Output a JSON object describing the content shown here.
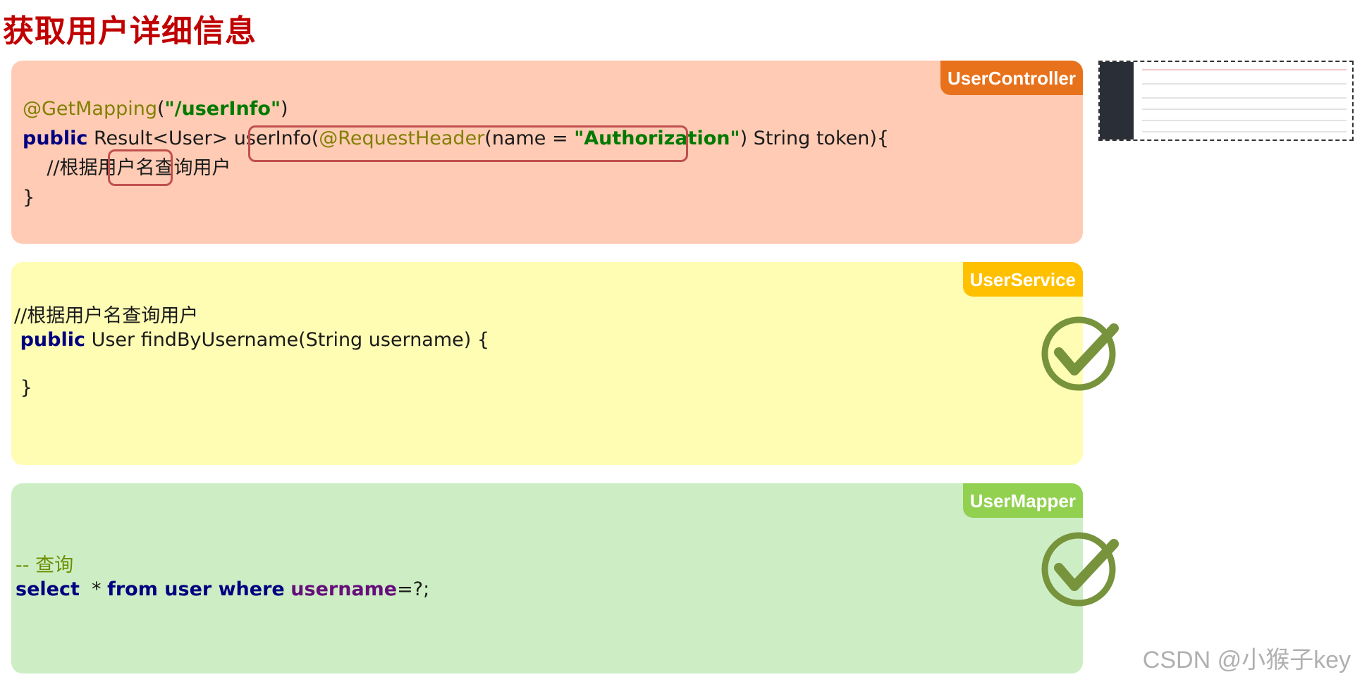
{
  "title": "获取用户详细信息",
  "controller": {
    "badge": "UserController",
    "line1_ann": "@GetMapping",
    "line1_open": "(",
    "line1_str": "\"/userInfo\"",
    "line1_close": ")",
    "line2_kw": "public",
    "line2_a": " Result<User> userInfo(",
    "line2_ann": "@RequestHeader",
    "line2_b": "(name = ",
    "line2_str": "\"Authorization\"",
    "line2_c": ") String token){",
    "line3": "    //根据用户名查询用户",
    "line4": "}"
  },
  "service": {
    "badge": "UserService",
    "line1": "//根据用户名查询用户",
    "line2_kw": "public",
    "line2_rest": " User findByUsername(String username) {",
    "line3": "}"
  },
  "mapper": {
    "badge": "UserMapper",
    "comment": "-- 查询",
    "sql_kw1": "select",
    "sql_a": "  * ",
    "sql_kw2": "from user where",
    "sql_sp": " ",
    "sql_col": "username",
    "sql_end": "=?;"
  },
  "watermark": "CSDN @小猴子key",
  "colors": {
    "title": "#c00000",
    "controller_bg": "#ffcbb4",
    "service_bg": "#fffdb4",
    "mapper_bg": "#cdeec5",
    "check": "#77933c"
  }
}
